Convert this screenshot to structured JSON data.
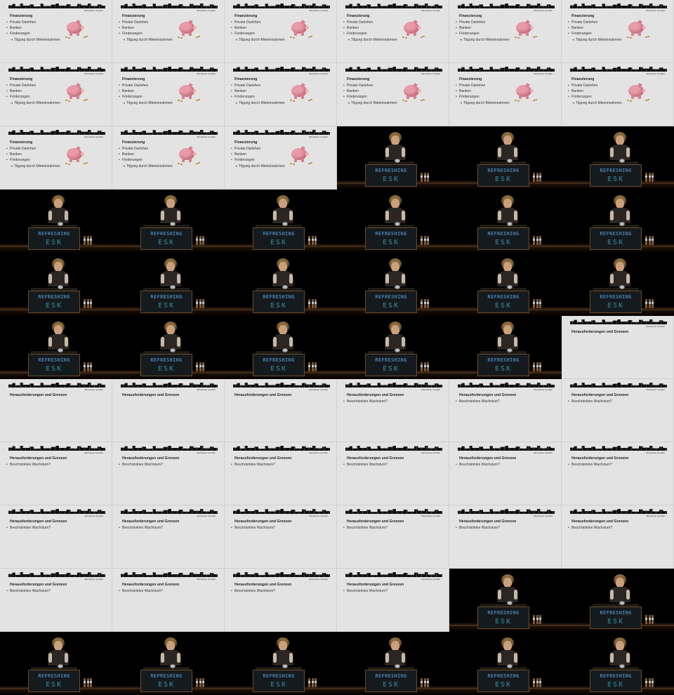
{
  "contact_sheet": {
    "columns": 6,
    "rows": 11,
    "frame_sequence": [
      "finance",
      "finance",
      "finance",
      "finance",
      "finance",
      "finance",
      "finance",
      "finance",
      "finance",
      "finance",
      "finance",
      "finance",
      "finance",
      "finance",
      "finance",
      "stage",
      "stage",
      "stage",
      "stage",
      "stage",
      "stage",
      "stage",
      "stage",
      "stage",
      "stage",
      "stage",
      "stage",
      "stage",
      "stage",
      "stage",
      "stage",
      "stage",
      "stage",
      "stage",
      "stage",
      "challenges_title",
      "challenges_title",
      "challenges_title",
      "challenges_title",
      "challenges_bullet",
      "challenges_bullet",
      "challenges_bullet",
      "challenges_bullet",
      "challenges_bullet",
      "challenges_bullet",
      "challenges_bullet",
      "challenges_bullet",
      "challenges_bullet",
      "challenges_bullet",
      "challenges_bullet",
      "challenges_bullet",
      "challenges_bullet",
      "challenges_bullet",
      "challenges_bullet",
      "challenges_bullet",
      "challenges_bullet",
      "challenges_bullet",
      "challenges_bullet",
      "stage",
      "stage",
      "stage",
      "stage",
      "stage",
      "stage",
      "stage",
      "stage"
    ]
  },
  "slide_brand": "Mietshäuser Syndikat",
  "slides": {
    "finance": {
      "title": "Finanzierung",
      "bullets": [
        "Private Darlehen",
        "Banken",
        "Förderungen"
      ],
      "sub_bullet": "Tilgung durch Mieteinnahmen",
      "illustration": "piggy-bank-icon"
    },
    "challenges_title": {
      "title": "Herausforderungen und Grenzen",
      "bullets": []
    },
    "challenges_bullet": {
      "title": "Herausforderungen und Grenzen",
      "bullets": [
        "Beschränktes Wachstum?"
      ]
    }
  },
  "stage": {
    "podium_word": "REFRESHING",
    "podium_logo": "ESK"
  },
  "colors": {
    "slide_background": "#e3e3e3",
    "stage_background": "#000000",
    "podium_text": "#4a7fa8"
  }
}
